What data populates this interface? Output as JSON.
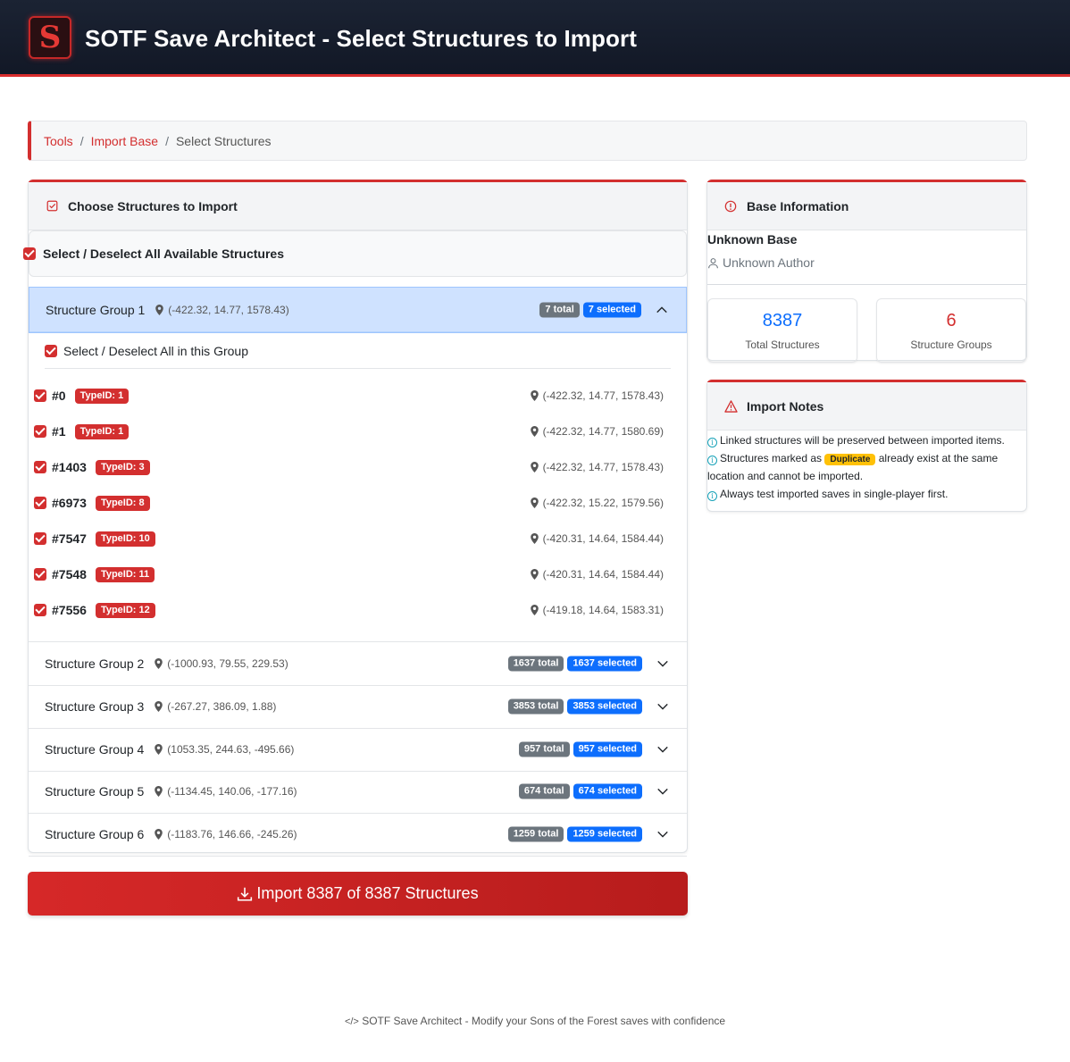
{
  "header": {
    "title": "SOTF Save Architect - Select Structures to Import",
    "logo_letter": "S"
  },
  "breadcrumb": {
    "items": [
      "Tools",
      "Import Base"
    ],
    "current": "Select Structures",
    "separator": "/"
  },
  "structures_card": {
    "title": "Choose Structures to Import",
    "select_all_label": "Select / Deselect All Available Structures",
    "group_select_label": "Select / Deselect All in this Group",
    "groups": [
      {
        "name": "Structure Group 1",
        "coords": "(-422.32, 14.77, 1578.43)",
        "total": "7 total",
        "selected": "7 selected",
        "expanded": true,
        "items": [
          {
            "id": "#0",
            "type": "TypeID: 1",
            "coords": "(-422.32, 14.77, 1578.43)"
          },
          {
            "id": "#1",
            "type": "TypeID: 1",
            "coords": "(-422.32, 14.77, 1580.69)"
          },
          {
            "id": "#1403",
            "type": "TypeID: 3",
            "coords": "(-422.32, 14.77, 1578.43)"
          },
          {
            "id": "#6973",
            "type": "TypeID: 8",
            "coords": "(-422.32, 15.22, 1579.56)"
          },
          {
            "id": "#7547",
            "type": "TypeID: 10",
            "coords": "(-420.31, 14.64, 1584.44)"
          },
          {
            "id": "#7548",
            "type": "TypeID: 11",
            "coords": "(-420.31, 14.64, 1584.44)"
          },
          {
            "id": "#7556",
            "type": "TypeID: 12",
            "coords": "(-419.18, 14.64, 1583.31)"
          }
        ]
      },
      {
        "name": "Structure Group 2",
        "coords": "(-1000.93, 79.55, 229.53)",
        "total": "1637 total",
        "selected": "1637 selected",
        "expanded": false
      },
      {
        "name": "Structure Group 3",
        "coords": "(-267.27, 386.09, 1.88)",
        "total": "3853 total",
        "selected": "3853 selected",
        "expanded": false
      },
      {
        "name": "Structure Group 4",
        "coords": "(1053.35, 244.63, -495.66)",
        "total": "957 total",
        "selected": "957 selected",
        "expanded": false
      },
      {
        "name": "Structure Group 5",
        "coords": "(-1134.45, 140.06, -177.16)",
        "total": "674 total",
        "selected": "674 selected",
        "expanded": false
      },
      {
        "name": "Structure Group 6",
        "coords": "(-1183.76, 146.66, -245.26)",
        "total": "1259 total",
        "selected": "1259 selected",
        "expanded": false
      }
    ]
  },
  "import_button": {
    "label": "Import 8387 of 8387 Structures"
  },
  "base_info": {
    "title": "Base Information",
    "name": "Unknown Base",
    "author": "Unknown Author",
    "total_structures": "8387",
    "total_structures_label": "Total Structures",
    "structure_groups": "6",
    "structure_groups_label": "Structure Groups"
  },
  "import_notes": {
    "title": "Import Notes",
    "note1": "Linked structures will be preserved between imported items.",
    "note2_before": "Structures marked as",
    "note2_badge": "Duplicate",
    "note2_after": "already exist at the same location and cannot be imported.",
    "note3": "Always test imported saves in single-player first."
  },
  "footer": {
    "text": "SOTF Save Architect - Modify your Sons of the Forest saves with confidence"
  },
  "colors": {
    "accent": "#d32f2f",
    "header_bg": "#141b2a",
    "badge_blue": "#0d6efd",
    "badge_gray": "#6c757d",
    "duplicate": "#ffc107"
  }
}
